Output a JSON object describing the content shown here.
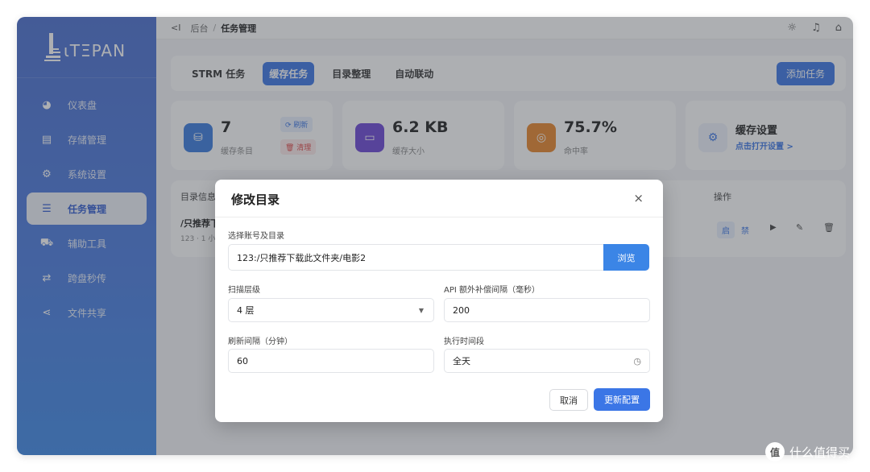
{
  "app": {
    "logo_text": "ιTΞPAN",
    "colors": {
      "accent": "#3b76e6",
      "sidebar": "#4a6fd0",
      "orange": "#e8862a",
      "purple": "#6c45d6",
      "blue_icon": "#3a7bde",
      "red": "#e04848"
    }
  },
  "sidebar": {
    "items": [
      {
        "label": "仪表盘",
        "icon": "dashboard-icon",
        "glyph": "◕"
      },
      {
        "label": "存储管理",
        "icon": "storage-icon",
        "glyph": "▤"
      },
      {
        "label": "系统设置",
        "icon": "settings-icon",
        "glyph": "⚙"
      },
      {
        "label": "任务管理",
        "icon": "task-list-icon",
        "glyph": "☰"
      },
      {
        "label": "辅助工具",
        "icon": "toolbox-icon",
        "glyph": "⛟"
      },
      {
        "label": "跨盘秒传",
        "icon": "transfer-icon",
        "glyph": "⇄"
      },
      {
        "label": "文件共享",
        "icon": "share-icon",
        "glyph": "⋖"
      }
    ]
  },
  "topbar": {
    "back_glyph": "<I",
    "breadcrumb_root": "后台",
    "breadcrumb_sep": "/",
    "breadcrumb_current": "任务管理"
  },
  "tabs": {
    "items": [
      "STRM 任务",
      "缓存任务",
      "目录整理",
      "自动联动"
    ],
    "add_button": "添加任务"
  },
  "stats": {
    "cache_count": {
      "value": "7",
      "label": "缓存条目",
      "refresh": "⟳ 刷新",
      "clear": "🗑 清理"
    },
    "cache_size": {
      "value": "6.2 KB",
      "label": "缓存大小"
    },
    "hit_rate": {
      "value": "75.7%",
      "label": "命中率"
    },
    "settings": {
      "title": "缓存设置",
      "link": "点击打开设置 >"
    }
  },
  "table": {
    "header_dir": "目录信息",
    "header_ops": "操作",
    "row": {
      "title": "/只推荐下",
      "sub": "123 · 1 小",
      "op_start": "启",
      "op_disable": "禁"
    }
  },
  "modal": {
    "title": "修改目录",
    "close": "×",
    "account_label": "选择账号及目录",
    "account_value": "123:/只推荐下载此文件夹/电影2",
    "browse": "浏览",
    "scan_label": "扫描层级",
    "scan_value": "4 层",
    "api_label": "API 额外补偿间隔（毫秒）",
    "api_value": "200",
    "refresh_label": "刷新间隔（分钟）",
    "refresh_value": "60",
    "exec_label": "执行时间段",
    "exec_value": "全天",
    "cancel": "取消",
    "submit": "更新配置"
  },
  "watermark": {
    "glyph": "值",
    "text": "什么值得买"
  }
}
